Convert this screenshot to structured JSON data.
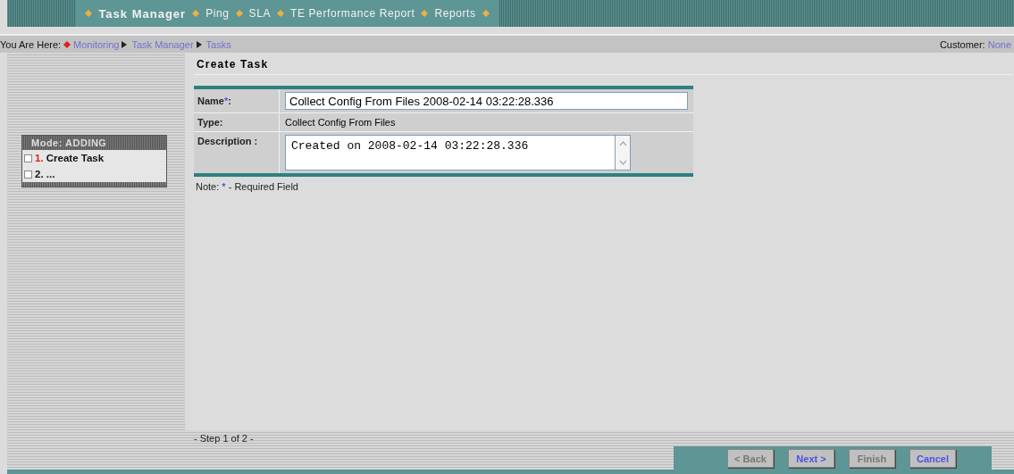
{
  "nav": [
    {
      "label": "Task Manager",
      "selected": true
    },
    {
      "label": "Ping",
      "selected": false
    },
    {
      "label": "SLA",
      "selected": false
    },
    {
      "label": "TE Performance Report",
      "selected": false
    },
    {
      "label": "Reports",
      "selected": false
    }
  ],
  "breadcrumb": {
    "prefix": "You Are Here:",
    "items": [
      "Monitoring",
      "Task Manager",
      "Tasks"
    ],
    "customer_label": "Customer:",
    "customer_value": "None"
  },
  "mode_panel": {
    "title": "Mode: ADDING",
    "steps": [
      {
        "number": "1.",
        "label": "Create Task",
        "selected": true
      },
      {
        "number": "2.",
        "label": "...",
        "selected": false
      }
    ]
  },
  "page_title": "Create Task",
  "form": {
    "name_label": "Name",
    "required_mark": "*",
    "name_colon": ":",
    "name_value": "Collect Config From Files 2008-02-14 03:22:28.336",
    "type_label": "Type:",
    "type_value": "Collect Config From Files",
    "description_label": "Description :",
    "description_value": "Created on 2008-02-14 03:22:28.336"
  },
  "note": {
    "prefix": "Note:",
    "mark": "*",
    "text": "- Required Field"
  },
  "step_indicator": "- Step 1 of 2 -",
  "buttons": [
    {
      "label": "< Back",
      "disabled": true
    },
    {
      "label": "Next >",
      "disabled": false
    },
    {
      "label": "Finish",
      "disabled": true
    },
    {
      "label": "Cancel",
      "disabled": false
    }
  ]
}
